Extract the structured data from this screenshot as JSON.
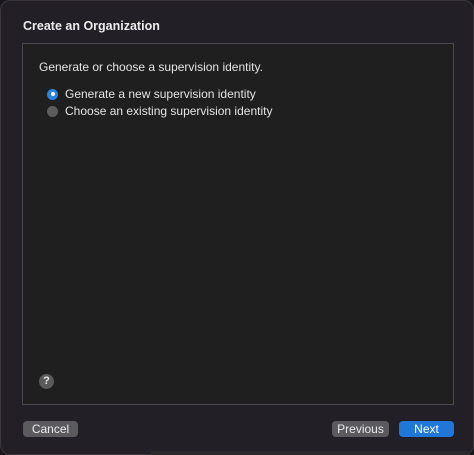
{
  "window": {
    "title": "Create an Organization"
  },
  "content": {
    "prompt": "Generate or choose a supervision identity.",
    "options": [
      {
        "label": "Generate a new supervision identity",
        "selected": true
      },
      {
        "label": "Choose an existing supervision identity",
        "selected": false
      }
    ],
    "help_glyph": "?"
  },
  "footer": {
    "cancel_label": "Cancel",
    "previous_label": "Previous",
    "next_label": "Next"
  },
  "colors": {
    "accent": "#1f78d8",
    "window_bg": "#231f26",
    "panel_bg": "#1f1f1f"
  },
  "icons": {
    "help": "question-mark-icon"
  }
}
